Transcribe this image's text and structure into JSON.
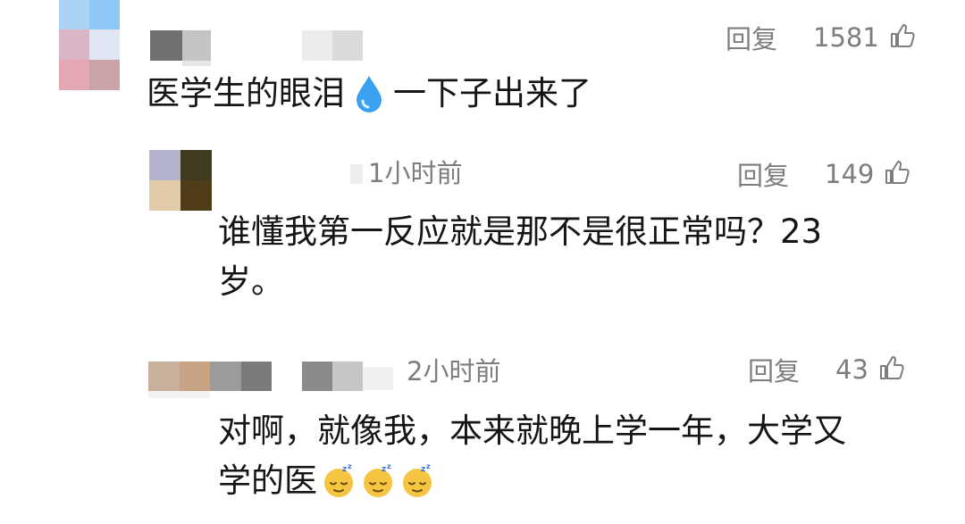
{
  "comments": [
    {
      "text": "医学生的眼泪",
      "text_after": "一下子出来了",
      "inline_icon": "droplet-icon",
      "time": "",
      "reply_label": "回复",
      "likes": "1581"
    },
    {
      "time": "1小时前",
      "text": "谁懂我第一反应就是那不是很正常吗？23",
      "text_line2": "岁。",
      "reply_label": "回复",
      "likes": "149"
    },
    {
      "time": "2小时前",
      "text": "对啊，就像我，本来就晚上学一年，大学又",
      "text_line2": "学的医",
      "trailing_icons": [
        "sleeping-face-icon",
        "sleeping-face-icon",
        "sleeping-face-icon"
      ],
      "reply_label": "回复",
      "likes": "43"
    }
  ],
  "colors": {
    "meta_gray": "#7d7d7d",
    "text_dark": "#151515",
    "droplet_blue": "#3aa0f0",
    "emoji_yellow": "#f5c542"
  }
}
